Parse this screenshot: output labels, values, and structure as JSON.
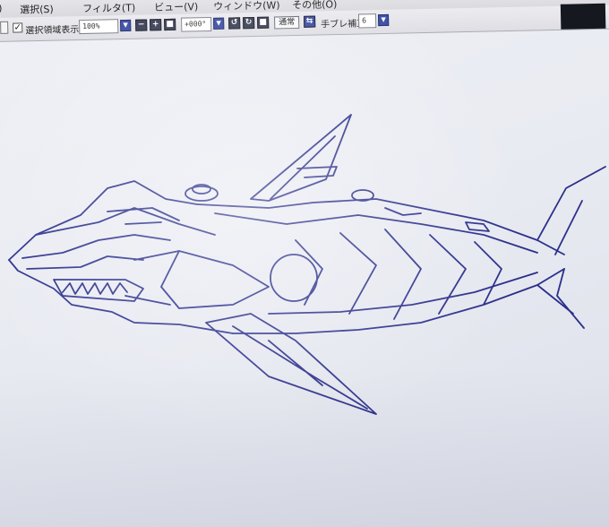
{
  "menubar": {
    "items": [
      {
        "label": ")"
      },
      {
        "label": "選択(S)"
      },
      {
        "label": "フィルタ(T)"
      },
      {
        "label": "ビュー(V)"
      },
      {
        "label": "ウィンドウ(W)"
      },
      {
        "label": "その他(O)"
      }
    ]
  },
  "toolbar": {
    "show_selection": {
      "label": "選択領域表示",
      "checked": true
    },
    "zoom": {
      "value": "100%"
    },
    "rotation": {
      "value": "+000°"
    },
    "blend_mode": {
      "label": "通常"
    },
    "stabilizer": {
      "label": "手ブレ補正",
      "value": "6"
    }
  },
  "icons": {
    "dropdown": "▼",
    "zoom_out": "−",
    "zoom_in": "+",
    "zoom_reset": "■",
    "rotate_left": "↺",
    "rotate_right": "↻",
    "rotate_reset": "■",
    "flip": "⇆"
  },
  "canvas": {
    "drawing": "mechanical-shark-sketch",
    "stroke_color": "#2b2f8a",
    "background_color": "#eceef4"
  }
}
